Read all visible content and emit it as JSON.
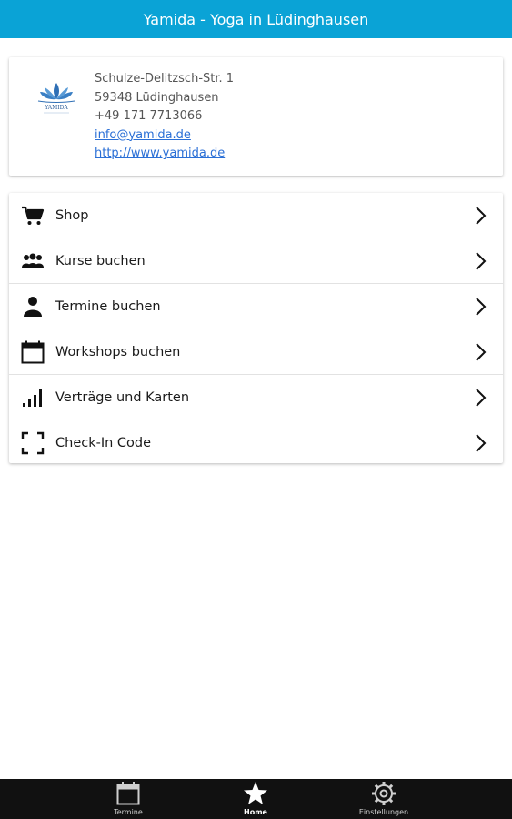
{
  "header": {
    "title": "Yamida - Yoga in Lüdinghausen"
  },
  "info": {
    "logo_text": "YAMIDA",
    "street": "Schulze-Delitzsch-Str. 1",
    "city": "59348 Lüdinghausen",
    "phone": "+49 171 7713066",
    "email": "info@yamida.de",
    "website": "http://www.yamida.de"
  },
  "menu": {
    "items": [
      {
        "label": "Shop",
        "icon": "cart-icon"
      },
      {
        "label": "Kurse buchen",
        "icon": "group-icon"
      },
      {
        "label": "Termine buchen",
        "icon": "person-icon"
      },
      {
        "label": "Workshops buchen",
        "icon": "calendar-icon"
      },
      {
        "label": "Verträge und Karten",
        "icon": "signal-bars-icon"
      },
      {
        "label": "Check-In Code",
        "icon": "scan-frame-icon"
      }
    ]
  },
  "bottom_nav": {
    "items": [
      {
        "label": "Termine",
        "icon": "calendar-icon",
        "active": false
      },
      {
        "label": "Home",
        "icon": "star-icon",
        "active": true
      },
      {
        "label": "Einstellungen",
        "icon": "gear-icon",
        "active": false
      }
    ]
  },
  "colors": {
    "header_bg": "#0aa3d6",
    "nav_bg": "#111111",
    "link": "#2a6fd6"
  }
}
